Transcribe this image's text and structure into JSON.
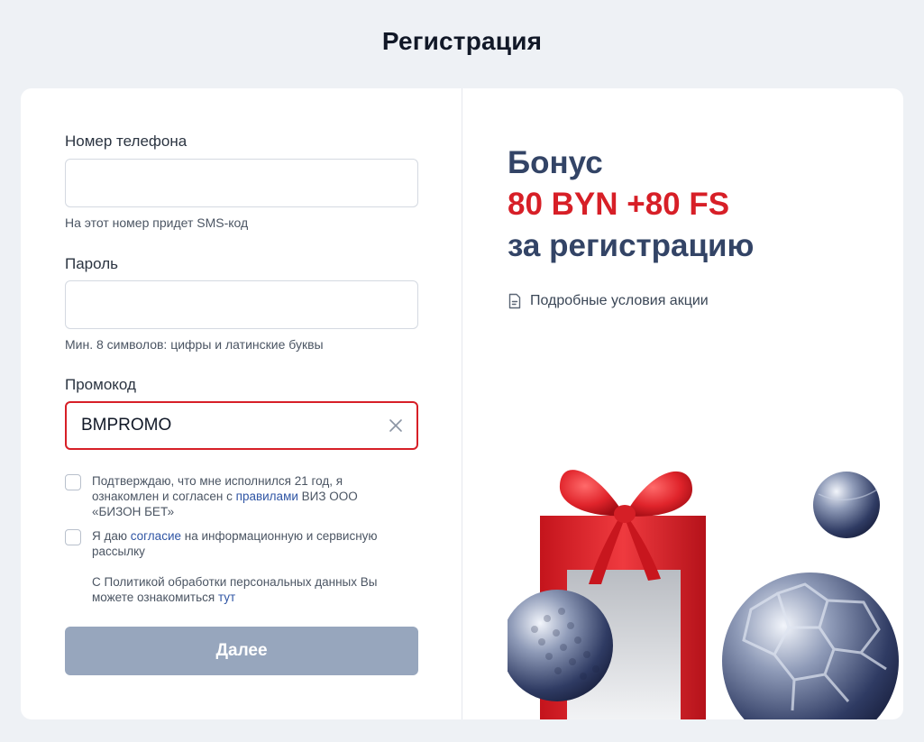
{
  "page": {
    "title": "Регистрация"
  },
  "form": {
    "phone": {
      "label": "Номер телефона",
      "value": "",
      "hint": "На этот номер придет SMS-код"
    },
    "password": {
      "label": "Пароль",
      "value": "",
      "hint": "Мин. 8 символов: цифры и латинские буквы"
    },
    "promo": {
      "label": "Промокод",
      "value": "BMPROMO"
    },
    "consent_age": {
      "checked": false,
      "text_before": "Подтверждаю, что мне исполнился 21 год, я ознакомлен и согласен с ",
      "link": "правилами",
      "text_after": " ВИЗ ООО «БИЗОН БЕТ»"
    },
    "consent_mailing": {
      "checked": false,
      "text_before": "Я даю ",
      "link": "согласие",
      "text_after": " на информационную и сервисную рассылку"
    },
    "privacy": {
      "text": "С Политикой обработки персональных данных Вы можете ознакомиться ",
      "link": "тут"
    },
    "submit_label": "Далее"
  },
  "promo_panel": {
    "line1": "Бонус",
    "line2": "80 BYN +80 FS",
    "line3": "за регистрацию",
    "terms_link": "Подробные условия акции",
    "terms_icon": "document-icon"
  },
  "colors": {
    "accent_red": "#d71f27",
    "heading_blue": "#334466",
    "link_blue": "#2f55a4",
    "button_disabled": "#97a6bd"
  }
}
